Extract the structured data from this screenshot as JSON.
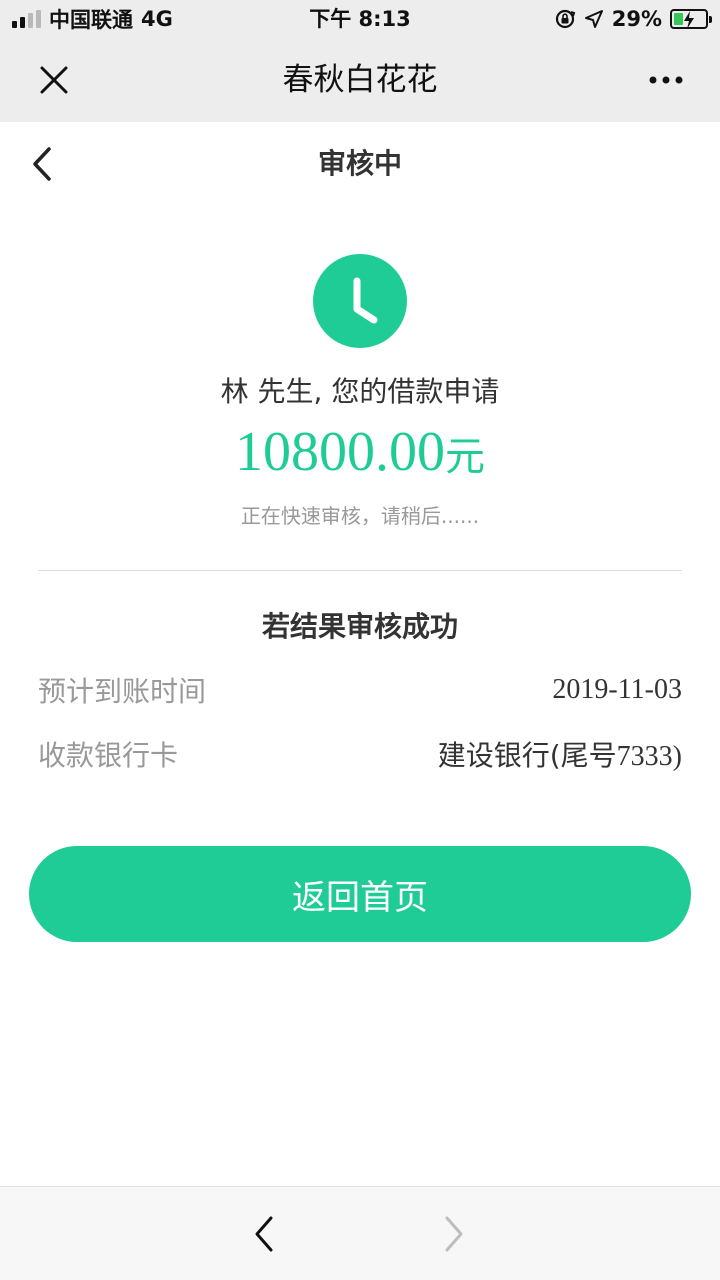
{
  "status_bar": {
    "carrier": "中国联通",
    "network": "4G",
    "time": "下午 8:13",
    "battery_percent": "29%",
    "battery_level": 0.29,
    "signal_bars": 2,
    "accent_green": "#35c759"
  },
  "title_bar": {
    "title": "春秋白花花",
    "close_icon": "close-icon",
    "more_icon": "more-icon"
  },
  "page": {
    "title": "审核中",
    "back_icon": "chevron-left-icon"
  },
  "application": {
    "status_icon": "clock-icon",
    "greeting": "林 先生, 您的借款申请",
    "amount": "10800.00",
    "amount_unit": "元",
    "hint": "正在快速审核，请稍后......"
  },
  "result": {
    "title": "若结果审核成功",
    "rows": [
      {
        "label": "预计到账时间",
        "value": "2019-11-03"
      },
      {
        "label": "收款银行卡",
        "value_prefix": "建设银行(尾号",
        "value_number": "7333",
        "value_suffix": ")"
      }
    ]
  },
  "buttons": {
    "home": "返回首页"
  },
  "browser_nav": {
    "back_icon": "chevron-left-icon",
    "forward_icon": "chevron-right-icon"
  },
  "colors": {
    "brand_green": "#20cc96",
    "bar_background": "#ededed"
  }
}
